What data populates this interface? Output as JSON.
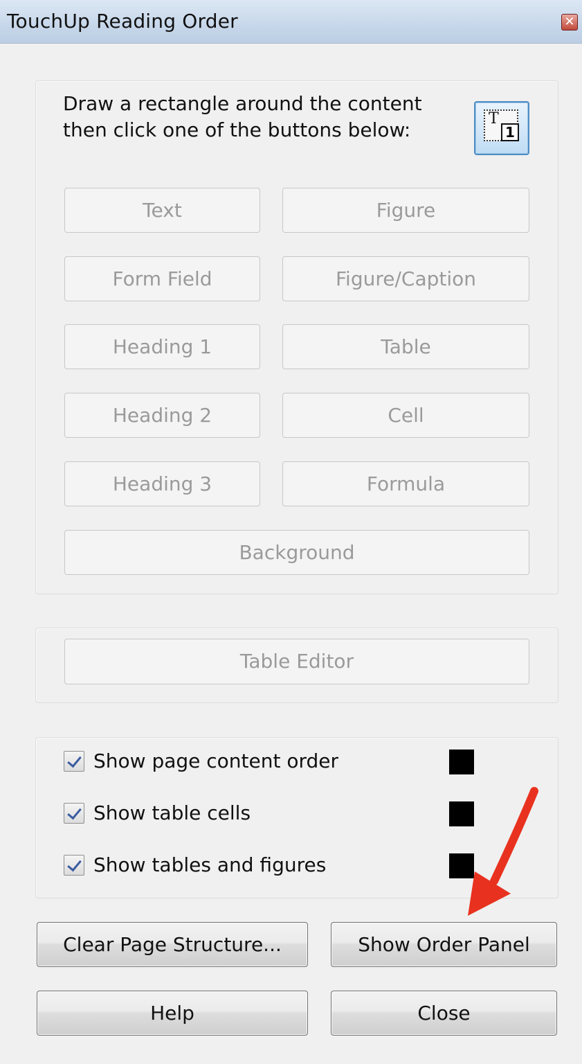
{
  "window": {
    "title": "TouchUp Reading Order",
    "close_glyph": "✕"
  },
  "instructions": "Draw a rectangle around the content then click one of the buttons below:",
  "tool_icon": {
    "name": "draw-rectangle-tool-icon",
    "glyph_letter": "T",
    "glyph_number": "1"
  },
  "tag_buttons": {
    "text": "Text",
    "figure": "Figure",
    "form_field": "Form Field",
    "figure_caption": "Figure/Caption",
    "heading1": "Heading 1",
    "table": "Table",
    "heading2": "Heading 2",
    "cell": "Cell",
    "heading3": "Heading 3",
    "formula": "Formula",
    "background": "Background"
  },
  "table_editor": "Table Editor",
  "checkboxes": [
    {
      "label": "Show page content order",
      "checked": true,
      "color": "#000000"
    },
    {
      "label": "Show table cells",
      "checked": true,
      "color": "#000000"
    },
    {
      "label": "Show tables and figures",
      "checked": true,
      "color": "#000000"
    }
  ],
  "actions": {
    "clear": "Clear Page Structure...",
    "show_order": "Show Order Panel",
    "help": "Help",
    "close": "Close"
  },
  "annotation": {
    "arrow_color": "#e8321f"
  }
}
